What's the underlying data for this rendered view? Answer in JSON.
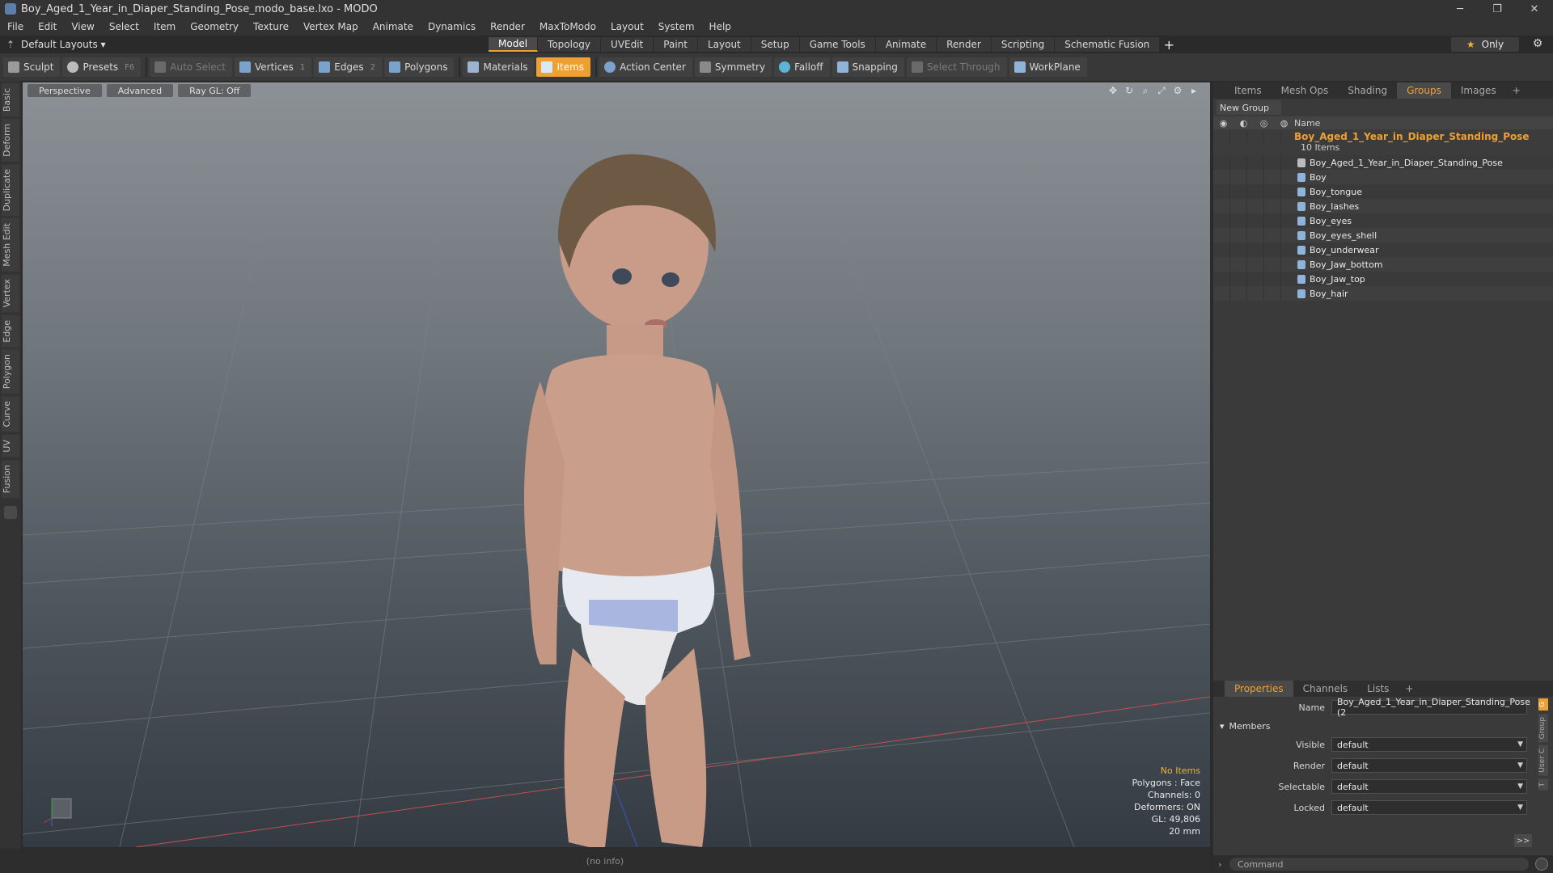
{
  "window": {
    "title": "Boy_Aged_1_Year_in_Diaper_Standing_Pose_modo_base.lxo - MODO",
    "min": "─",
    "max": "❐",
    "close": "✕"
  },
  "menu": [
    "File",
    "Edit",
    "View",
    "Select",
    "Item",
    "Geometry",
    "Texture",
    "Vertex Map",
    "Animate",
    "Dynamics",
    "Render",
    "MaxToModo",
    "Layout",
    "System",
    "Help"
  ],
  "layout": {
    "dropdown": "Default Layouts ▾",
    "tabs": [
      "Model",
      "Topology",
      "UVEdit",
      "Paint",
      "Layout",
      "Setup",
      "Game Tools",
      "Animate",
      "Render",
      "Scripting",
      "Schematic Fusion"
    ],
    "active": "Model",
    "only": "Only"
  },
  "toolbar": {
    "sculpt": "Sculpt",
    "presets": "Presets",
    "presets_key": "F6",
    "auto_select": "Auto Select",
    "vertices": "Vertices",
    "vertices_count": "1",
    "edges": "Edges",
    "edges_count": "2",
    "polygons": "Polygons",
    "materials": "Materials",
    "items": "Items",
    "action_center": "Action Center",
    "symmetry": "Symmetry",
    "falloff": "Falloff",
    "snapping": "Snapping",
    "select_through": "Select Through",
    "workplane": "WorkPlane"
  },
  "left_tabs": [
    "Basic",
    "Deform",
    "Duplicate",
    "Mesh Edit",
    "Vertex",
    "Edge",
    "Polygon",
    "Curve",
    "UV",
    "Fusion"
  ],
  "viewport": {
    "perspective": "Perspective",
    "advanced": "Advanced",
    "raygl": "Ray GL: Off",
    "info": {
      "no_items": "No Items",
      "polygons": "Polygons : Face",
      "channels": "Channels: 0",
      "deformers": "Deformers: ON",
      "gl": "GL: 49,806",
      "scale": "20 mm"
    }
  },
  "groups_panel": {
    "tabs": [
      "Items",
      "Mesh Ops",
      "Shading",
      "Groups",
      "Images"
    ],
    "active": "Groups",
    "new_group": "New Group",
    "name_header": "Name",
    "root": {
      "name": "Boy_Aged_1_Year_in_Diaper_Standing_Pose",
      "count": "10 Items"
    },
    "items": [
      "Boy_Aged_1_Year_in_Diaper_Standing_Pose",
      "Boy",
      "Boy_tongue",
      "Boy_lashes",
      "Boy_eyes",
      "Boy_eyes_shell",
      "Boy_underwear",
      "Boy_Jaw_bottom",
      "Boy_Jaw_top",
      "Boy_hair"
    ]
  },
  "properties": {
    "tabs": [
      "Properties",
      "Channels",
      "Lists"
    ],
    "active": "Properties",
    "name_label": "Name",
    "name_value": "Boy_Aged_1_Year_in_Diaper_Standing_Pose (2",
    "members": "Members",
    "visible_label": "Visible",
    "visible": "default",
    "render_label": "Render",
    "render": "default",
    "selectable_label": "Selectable",
    "selectable": "default",
    "locked_label": "Locked",
    "locked": "default",
    "more": ">>"
  },
  "status": "(no info)",
  "command_placeholder": "Command",
  "colors": {
    "accent": "#f0a030"
  }
}
